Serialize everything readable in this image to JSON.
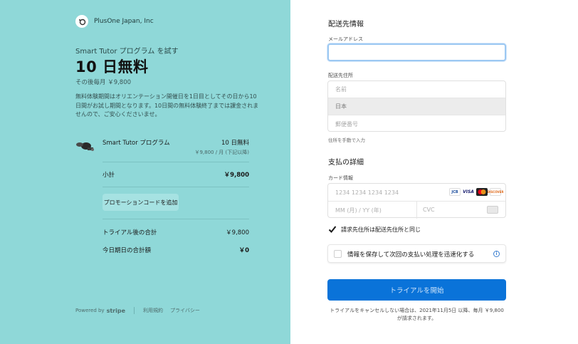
{
  "merchant": {
    "name": "PlusOne Japan, Inc"
  },
  "summary": {
    "subtitle": "Smart Tutor プログラム を試す",
    "title": "10 日無料",
    "price_after": "その後毎月 ￥9,800",
    "description": "無料体験期間はオリエンテーション開催日を1日目としてその日から10日間がお試し期間となります。10日間の無料体験終了までは課金されませんので、ご安心くださいませ。"
  },
  "line_item": {
    "name": "Smart Tutor プログラム",
    "price": "10 日無料",
    "sub": "￥9,800 / 月 (下記以降)"
  },
  "totals": {
    "subtotal_label": "小計",
    "subtotal_value": "￥9,800",
    "promo_label": "プロモーションコードを追加",
    "after_trial_label": "トライアル後の合計",
    "after_trial_value": "￥9,800",
    "today_label": "今日期日の合計額",
    "today_value": "￥0"
  },
  "footer": {
    "powered": "Powered by",
    "stripe": "stripe",
    "terms": "利用規約",
    "privacy": "プライバシー"
  },
  "shipping": {
    "title": "配送先情報",
    "email_label": "メールアドレス",
    "email_value": "",
    "address_label": "配送先住所",
    "name_placeholder": "名前",
    "country": "日本",
    "postal_placeholder": "郵便番号",
    "manual_link": "住所を手動で入力"
  },
  "payment": {
    "title": "支払の詳細",
    "card_label": "カード情報",
    "card_placeholder": "1234 1234 1234 1234",
    "exp_placeholder": "MM (月) / YY (年)",
    "cvc_placeholder": "CVC",
    "brands": [
      "JCB",
      "VISA",
      "MC",
      "DISCOVER"
    ]
  },
  "billing_same": {
    "label": "請求先住所は配送先住所と同じ",
    "checked": true
  },
  "save_info": {
    "label": "情報を保存して次回の支払い処理を迅速化する"
  },
  "submit": {
    "label": "トライアルを開始"
  },
  "terms": {
    "text": "トライアルをキャンセルしない場合は、2021年11月5日 以降、毎月 ￥9,800 が請求されます。"
  },
  "colors": {
    "left_bg": "#8fd8d8",
    "button": "#0a73d9"
  }
}
